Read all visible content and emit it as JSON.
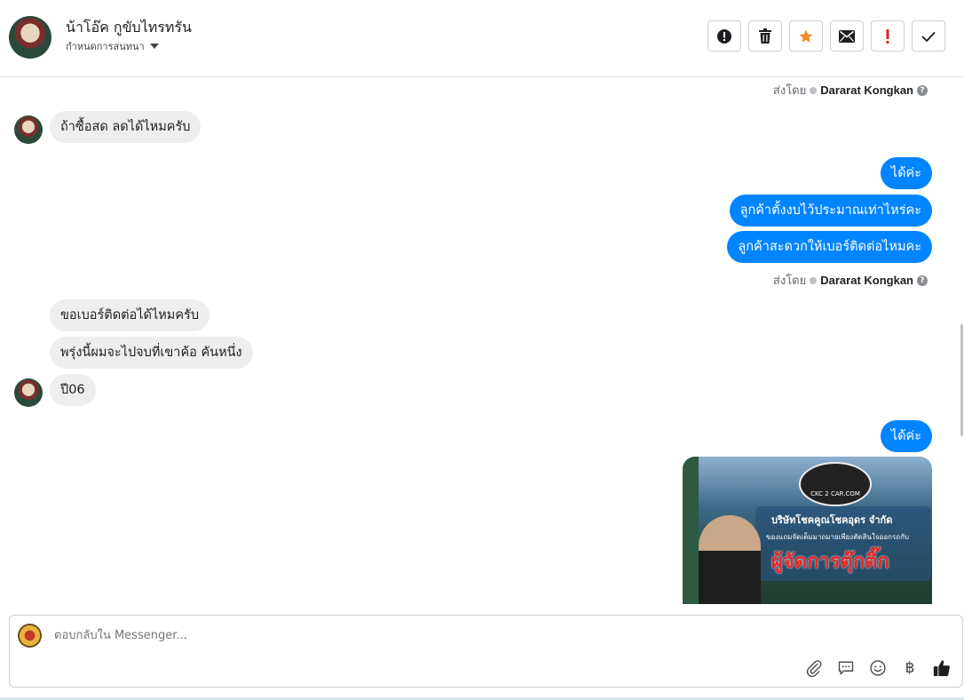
{
  "header": {
    "contact_name": "น้าโอ๊ค กูขับไทรทรัน",
    "assign_label": "กำหนดการสนทนา",
    "actions": [
      {
        "name": "spam-button",
        "icon": "alert-circle-icon"
      },
      {
        "name": "delete-button",
        "icon": "trash-icon"
      },
      {
        "name": "star-button",
        "icon": "star-icon"
      },
      {
        "name": "mark-unread-button",
        "icon": "envelope-icon"
      },
      {
        "name": "follow-up-button",
        "icon": "exclamation-icon"
      },
      {
        "name": "done-button",
        "icon": "check-icon"
      }
    ]
  },
  "thread": {
    "sent_by_prefix": "ส่งโดย",
    "agent_name": "Dararat Kongkan",
    "messages": [
      {
        "from": "customer",
        "text": "ถ้าซื้อสด ลดได้ไหมครับ"
      },
      {
        "from": "page",
        "text": "ได้ค่ะ"
      },
      {
        "from": "page",
        "text": "ลูกค้าตั้งงบไว้ประมาณเท่าไหร่คะ"
      },
      {
        "from": "page",
        "text": "ลูกค้าสะดวกให้เบอร์ติดต่อไหมคะ"
      },
      {
        "from": "customer",
        "text": "ขอเบอร์ติดต่อได้ไหมครับ"
      },
      {
        "from": "customer",
        "text": "พรุ่งนี้ผมจะไปจบที่เขาค้อ คันหนึ่ง"
      },
      {
        "from": "customer",
        "text": "ปี06"
      },
      {
        "from": "page",
        "text": "ได้ค่ะ"
      }
    ],
    "image_message": {
      "logo_text": "CKC 2 CAR.COM",
      "company": "บริษัทโชคคูณโชคอุดร จำกัด",
      "tagline": "ของแถมจัดเต็มมาถมายเพียงตัดสินใจออกรถกับ",
      "title": "ผู้จัดการตุ๊กติ๊ก"
    }
  },
  "composer": {
    "placeholder": "ตอบกลับใน Messenger...",
    "tools": [
      "paperclip-icon",
      "saved-reply-icon",
      "emoji-icon",
      "baht-icon",
      "thumbs-up-icon"
    ]
  },
  "colors": {
    "outgoing_bubble": "#0084ff",
    "incoming_bubble": "#eeeeee",
    "star": "#f28b25",
    "follow_up": "#e02424"
  }
}
